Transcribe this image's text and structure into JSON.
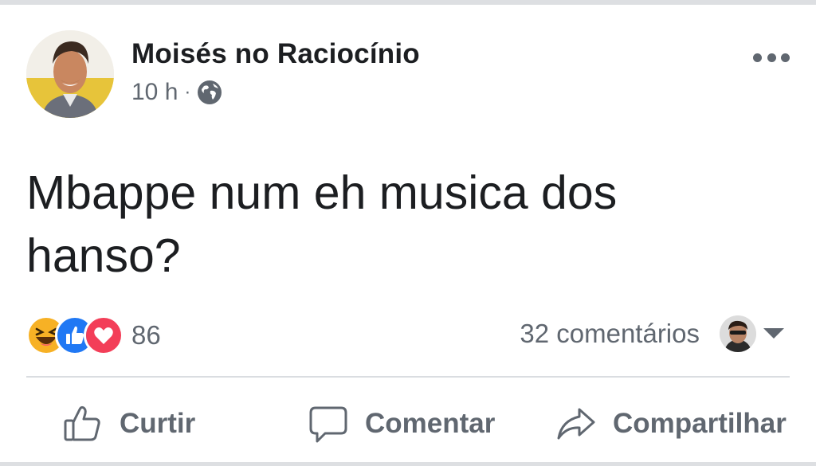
{
  "post": {
    "author": "Moisés no Raciocínio",
    "time": "10 h",
    "separator": "·",
    "privacy_icon": "globe-icon",
    "text": "Mbappe num eh musica dos hanso?"
  },
  "reactions": {
    "types": [
      "haha",
      "like",
      "love"
    ],
    "count": "86"
  },
  "comments_label": "32 comentários",
  "actions": {
    "like": "Curtir",
    "comment": "Comentar",
    "share": "Compartilhar"
  },
  "colors": {
    "like_blue": "#2078f4",
    "love_red": "#f33e58",
    "haha_yellow": "#f7b125",
    "secondary_text": "#606770"
  }
}
